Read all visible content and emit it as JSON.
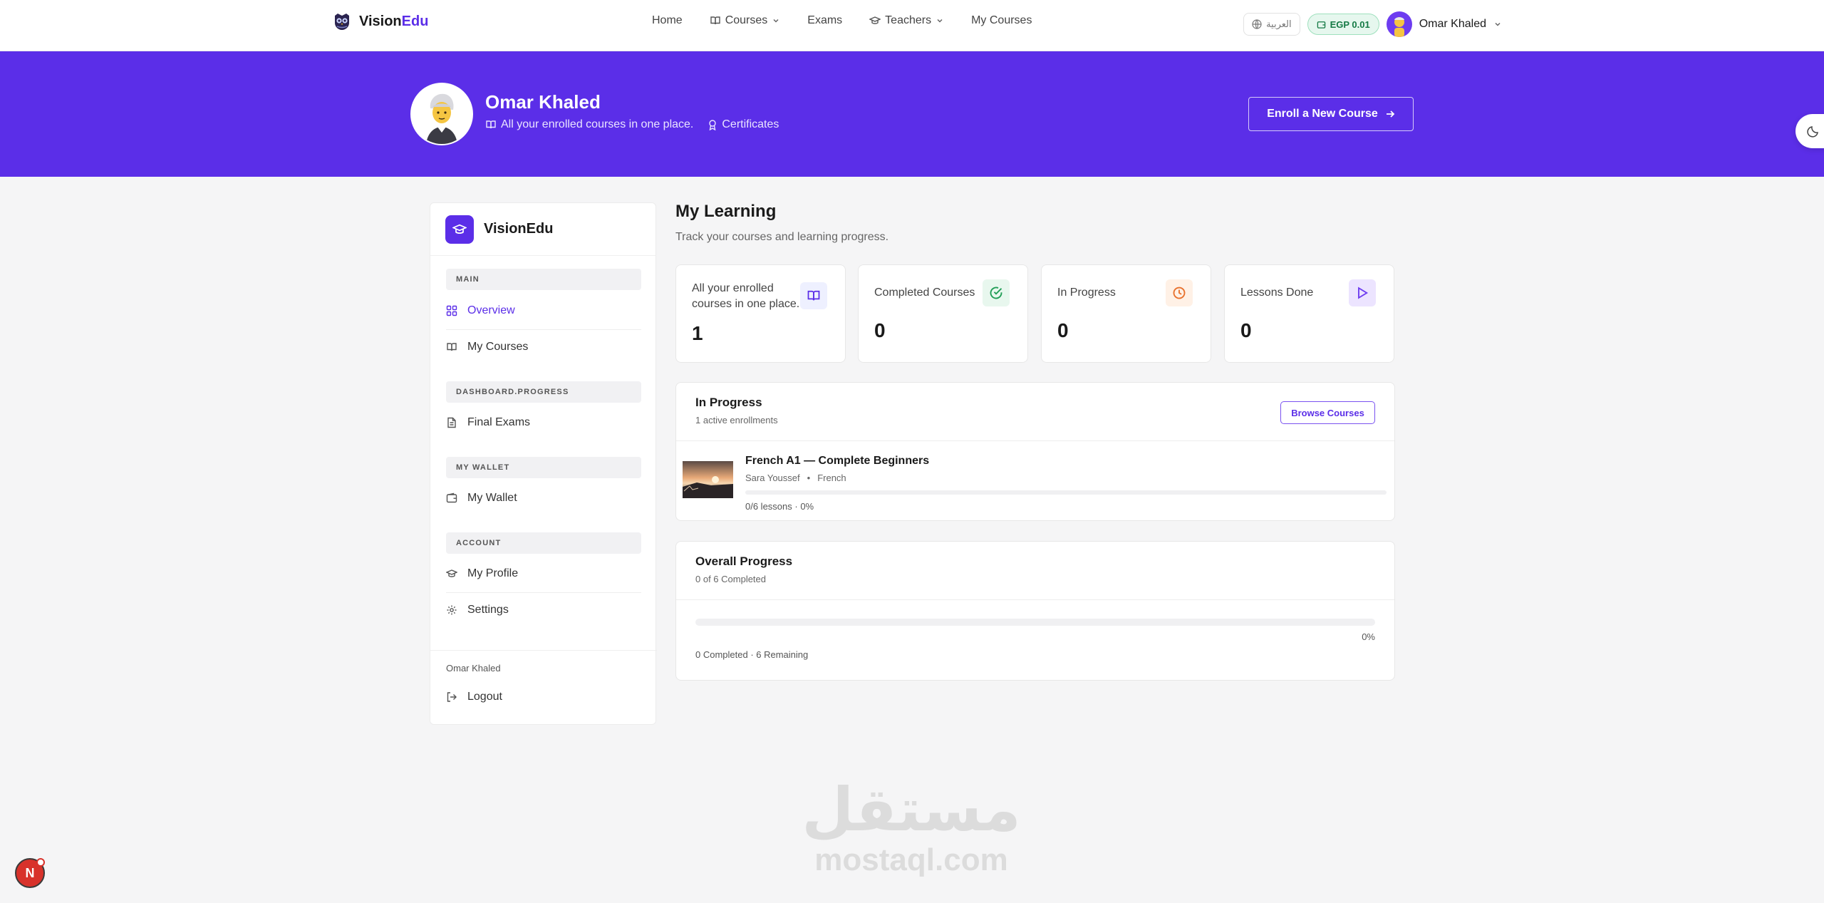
{
  "navbar": {
    "brand_main": "Vision",
    "brand_accent": "Edu",
    "links": {
      "home": "Home",
      "courses": "Courses",
      "exams": "Exams",
      "teachers": "Teachers",
      "my_courses": "My Courses"
    },
    "language": "العربية",
    "wallet_balance": "EGP 0.01",
    "user_name": "Omar Khaled"
  },
  "hero": {
    "name": "Omar Khaled",
    "subtitle": "All your enrolled courses in one place.",
    "certificates": "Certificates",
    "enroll_button": "Enroll a New Course"
  },
  "sidebar": {
    "title": "VisionEdu",
    "sections": {
      "main": "MAIN",
      "progress": "DASHBOARD.PROGRESS",
      "wallet": "MY WALLET",
      "account": "ACCOUNT"
    },
    "items": {
      "overview": "Overview",
      "my_courses": "My Courses",
      "final_exams": "Final Exams",
      "my_wallet": "My Wallet",
      "my_profile": "My Profile",
      "settings": "Settings",
      "logout": "Logout"
    },
    "footer_user": "Omar Khaled"
  },
  "main": {
    "title": "My Learning",
    "subtitle": "Track your courses and learning progress.",
    "stats": [
      {
        "label": "All your enrolled courses in one place.",
        "value": "1",
        "icon": "book-open-icon",
        "color": "#5b2ee8"
      },
      {
        "label": "Completed Courses",
        "value": "0",
        "icon": "check-circle-icon",
        "color": "#1f9d55"
      },
      {
        "label": "In Progress",
        "value": "0",
        "icon": "clock-icon",
        "color": "#e8712d"
      },
      {
        "label": "Lessons Done",
        "value": "0",
        "icon": "play-icon",
        "color": "#6d3cf0"
      }
    ],
    "in_progress": {
      "title": "In Progress",
      "subtitle": "1 active enrollments",
      "browse_button": "Browse Courses",
      "course": {
        "title": "French A1 — Complete Beginners",
        "teacher": "Sara Youssef",
        "separator": "•",
        "language": "French",
        "progress_text": "0/6 lessons · 0%",
        "progress": 0
      }
    },
    "overall": {
      "title": "Overall Progress",
      "subtitle": "0 of 6 Completed",
      "percent_text": "0%",
      "progress": 0,
      "summary": "0 Completed · 6 Remaining"
    }
  },
  "watermark": {
    "arabic": "مستقل",
    "latin": "mostaql.com"
  },
  "badge": {
    "letter": "N"
  },
  "colors": {
    "brand": "#5b2ee8",
    "success": "#1f9d55",
    "warning": "#e8712d",
    "background": "#f5f5f6"
  }
}
